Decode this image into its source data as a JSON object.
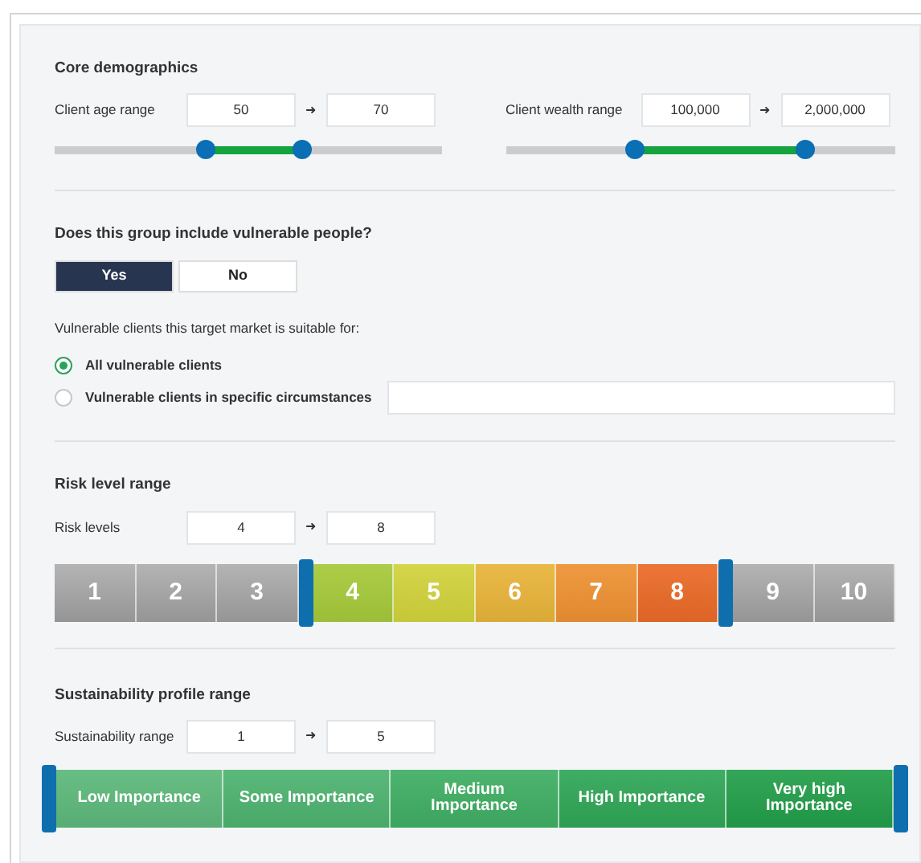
{
  "core_demographics": {
    "title": "Core demographics",
    "ranges": [
      {
        "label": "Client age range",
        "from": "50",
        "arrow": "➜",
        "to": "70",
        "thumbs": [
          {
            "level": 0.39
          },
          {
            "level": 0.64
          }
        ]
      },
      {
        "label": "Client wealth range",
        "from": "100,000",
        "arrow": "➜",
        "to": "2,000,000",
        "thumbs": [
          {
            "level": 0.33
          },
          {
            "level": 0.77
          }
        ]
      }
    ]
  },
  "vulnerable": {
    "question": "Does this group include vulnerable people?",
    "options": [
      {
        "label": "Yes",
        "selected": true
      },
      {
        "label": "No",
        "selected": false
      }
    ],
    "suitable_label": "Vulnerable clients this target market is suitable for:",
    "radios": [
      {
        "label": "All vulnerable clients",
        "selected": true,
        "kind": "plain"
      },
      {
        "label": "Vulnerable clients in specific circumstances",
        "selected": false,
        "kind": "with-field"
      }
    ]
  },
  "risk": {
    "title": "Risk level range",
    "label": "Risk levels",
    "from": "4",
    "arrow": "➜",
    "to": "8",
    "segments": [
      {
        "label": "1",
        "selected": false
      },
      {
        "label": "2",
        "selected": false
      },
      {
        "label": "3",
        "selected": false
      },
      {
        "label": "4",
        "selected": true,
        "color": "#a6c93a"
      },
      {
        "label": "5",
        "selected": true,
        "color": "#d1d23b"
      },
      {
        "label": "6",
        "selected": true,
        "color": "#e8b43a"
      },
      {
        "label": "7",
        "selected": true,
        "color": "#ee9133"
      },
      {
        "label": "8",
        "selected": true,
        "color": "#ea6a27"
      },
      {
        "label": "9",
        "selected": false
      },
      {
        "label": "10",
        "selected": false
      }
    ]
  },
  "sustainability": {
    "title": "Sustainability profile range",
    "label": "Sustainability range",
    "from": "1",
    "arrow": "➜",
    "to": "5",
    "segments": [
      {
        "label": "Low Importance",
        "selected": true,
        "color": "#5cb87a"
      },
      {
        "label": "Some Importance",
        "selected": true,
        "color": "#4db36f"
      },
      {
        "label": "Medium Importance",
        "selected": true,
        "color": "#3fae63"
      },
      {
        "label": "High Importance",
        "selected": true,
        "color": "#2fa656"
      },
      {
        "label": "Very high Importance",
        "selected": true,
        "color": "#229e4a"
      }
    ]
  }
}
